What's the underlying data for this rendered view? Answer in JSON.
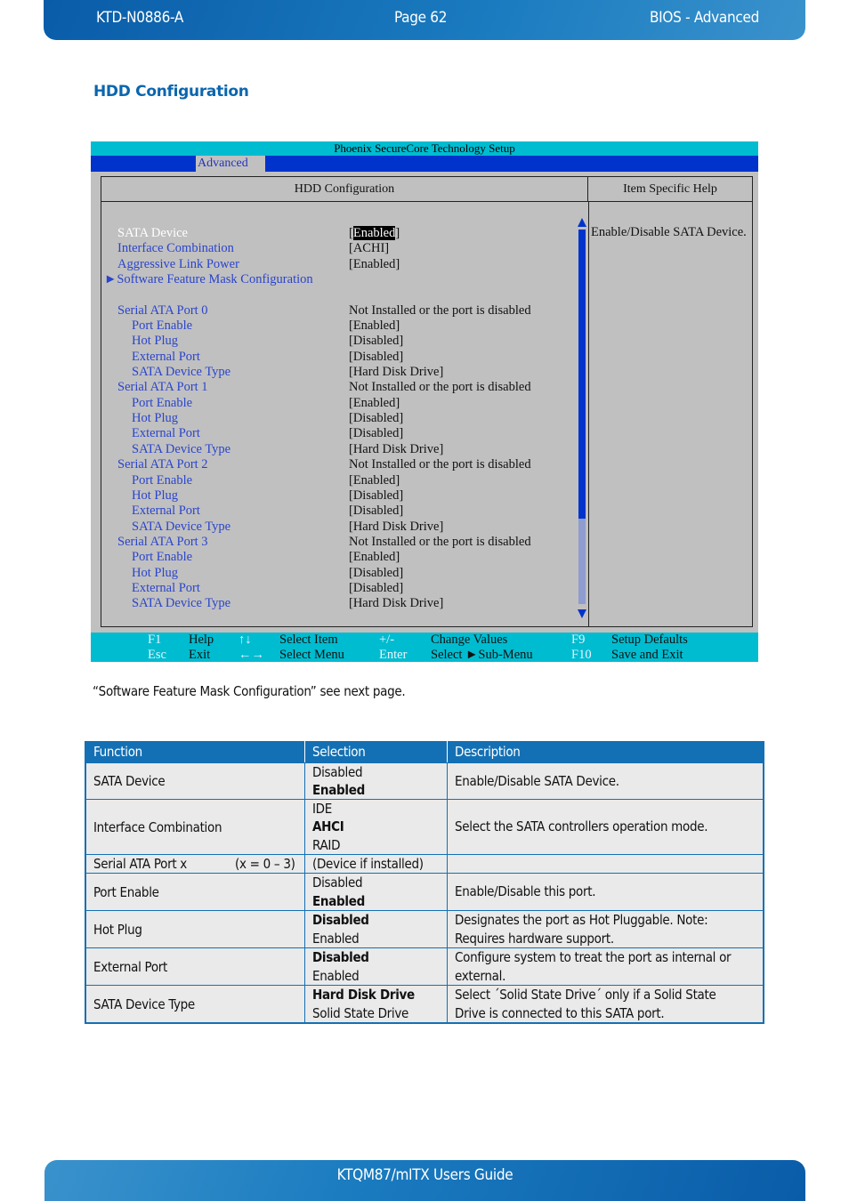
{
  "header": {
    "doc_id": "KTD-N0886-A",
    "page": "Page 62",
    "section": "BIOS  - Advanced"
  },
  "section_title": "HDD Configuration",
  "bios": {
    "title": "Phoenix SecureCore Technology Setup",
    "active_menu": "Advanced",
    "panel_title": "HDD Configuration",
    "help_title": "Item Specific Help",
    "help_text": "Enable/Disable SATA Device.",
    "scroll_position": 0.0,
    "items": [
      {
        "label": "SATA Device",
        "value_prefix": "[",
        "value": "Enabled",
        "value_suffix": "]",
        "level": 0,
        "selected": true
      },
      {
        "label": "Interface Combination",
        "value": "[ACHI]",
        "level": 0
      },
      {
        "label": "Aggressive Link Power",
        "value": "[Enabled]",
        "level": 0
      },
      {
        "label": "Software Feature Mask Configuration",
        "value": "",
        "level": "sub",
        "submenu_icon": "►"
      },
      {
        "spacer": true
      },
      {
        "label": "Serial ATA Port 0",
        "value": "Not Installed or the port is disabled",
        "level": 0
      },
      {
        "label": "Port Enable",
        "value": "[Enabled]",
        "level": 1
      },
      {
        "label": "Hot Plug",
        "value": "[Disabled]",
        "level": 1
      },
      {
        "label": "External Port",
        "value": "[Disabled]",
        "level": 1
      },
      {
        "label": "SATA Device Type",
        "value": "[Hard Disk Drive]",
        "level": 1
      },
      {
        "label": "Serial ATA Port 1",
        "value": "Not Installed or the port is disabled",
        "level": 0
      },
      {
        "label": "Port Enable",
        "value": "[Enabled]",
        "level": 1
      },
      {
        "label": "Hot Plug",
        "value": "[Disabled]",
        "level": 1
      },
      {
        "label": "External Port",
        "value": "[Disabled]",
        "level": 1
      },
      {
        "label": "SATA Device Type",
        "value": "[Hard Disk Drive]",
        "level": 1
      },
      {
        "label": "Serial ATA Port 2",
        "value": "Not Installed or the port is disabled",
        "level": 0
      },
      {
        "label": "Port Enable",
        "value": "[Enabled]",
        "level": 1
      },
      {
        "label": "Hot Plug",
        "value": "[Disabled]",
        "level": 1
      },
      {
        "label": "External Port",
        "value": "[Disabled]",
        "level": 1
      },
      {
        "label": "SATA Device Type",
        "value": "[Hard Disk Drive]",
        "level": 1
      },
      {
        "label": "Serial ATA Port 3",
        "value": "Not Installed or the port is disabled",
        "level": 0
      },
      {
        "label": "Port Enable",
        "value": "[Enabled]",
        "level": 1
      },
      {
        "label": "Hot Plug",
        "value": "[Disabled]",
        "level": 1
      },
      {
        "label": "External Port",
        "value": "[Disabled]",
        "level": 1
      },
      {
        "label": "SATA Device Type",
        "value": "[Hard Disk Drive]",
        "level": 1
      }
    ],
    "footer": {
      "row1": [
        {
          "key": "F1",
          "text": "Help"
        },
        {
          "key": "↑↓",
          "text": "Select Item"
        },
        {
          "key": "+/-",
          "text": "Change Values"
        },
        {
          "key": "F9",
          "text": "Setup Defaults"
        }
      ],
      "row2": [
        {
          "key": "Esc",
          "text": "Exit"
        },
        {
          "key": "←→",
          "text": "Select Menu"
        },
        {
          "key": "Enter",
          "text": "Select ►Sub-Menu"
        },
        {
          "key": "F10",
          "text": "Save and Exit"
        }
      ]
    }
  },
  "note": "“Software Feature Mask Configuration” see next page.",
  "table": {
    "headers": [
      "Function",
      "Selection",
      "Description"
    ],
    "rows": [
      {
        "function": "SATA Device",
        "function_extra": "",
        "selections": [
          {
            "text": "Disabled",
            "bold": false
          },
          {
            "text": "Enabled",
            "bold": true
          }
        ],
        "description": [
          "Enable/Disable SATA Device."
        ]
      },
      {
        "function": "Interface Combination",
        "function_extra": "",
        "selections": [
          {
            "text": "IDE",
            "bold": false
          },
          {
            "text": "AHCI",
            "bold": true
          },
          {
            "text": "RAID",
            "bold": false
          }
        ],
        "description": [
          "Select the SATA controllers operation mode."
        ]
      },
      {
        "function": "Serial ATA Port x",
        "function_extra": "(x = 0 – 3)",
        "selections": [
          {
            "text": "(Device if installed)",
            "bold": false
          }
        ],
        "description": [
          ""
        ]
      },
      {
        "function": "Port Enable",
        "function_extra": "",
        "selections": [
          {
            "text": "Disabled",
            "bold": false
          },
          {
            "text": "Enabled",
            "bold": true
          }
        ],
        "description": [
          "Enable/Disable this port."
        ]
      },
      {
        "function": "Hot Plug",
        "function_extra": "",
        "selections": [
          {
            "text": "Disabled",
            "bold": true
          },
          {
            "text": "Enabled",
            "bold": false
          }
        ],
        "description": [
          "Designates the port as Hot Pluggable. Note:",
          "Requires hardware support."
        ]
      },
      {
        "function": "External Port",
        "function_extra": "",
        "selections": [
          {
            "text": "Disabled",
            "bold": true
          },
          {
            "text": "Enabled",
            "bold": false
          }
        ],
        "description": [
          "Configure system to treat the port as internal or",
          "external."
        ]
      },
      {
        "function": "SATA Device Type",
        "function_extra": "",
        "selections": [
          {
            "text": "Hard Disk Drive",
            "bold": true
          },
          {
            "text": "Solid State Drive",
            "bold": false
          }
        ],
        "description": [
          "Select ´Solid State Drive´ only if a Solid State",
          "Drive is connected to this SATA port."
        ]
      }
    ]
  },
  "footer": {
    "title": "KTQM87/mITX Users Guide"
  },
  "colors": {
    "brand_blue": "#1470b4",
    "bios_cyan": "#00bcd0",
    "bios_blue": "#0033cc",
    "bios_gray": "#c0c0c0",
    "bios_item_blue": "#2a44cc"
  }
}
